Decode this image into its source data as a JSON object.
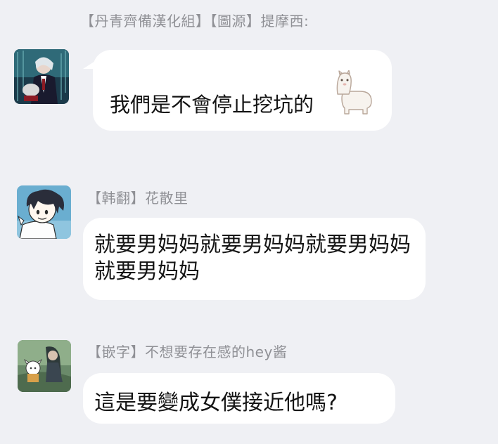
{
  "messages": [
    {
      "sender": "【丹青齊備漢化組】【圖源】提摩西:",
      "text": "我們是不會停止挖坑的",
      "sticker_icon": "alpaca-icon"
    },
    {
      "sender": "【韩翻】花散里",
      "text": "就要男妈妈就要男妈妈就要男妈妈就要男妈妈"
    },
    {
      "sender": "【嵌字】不想要存在感的hey酱",
      "text": "這是要變成女僕接近他嗎?"
    }
  ],
  "colors": {
    "background": "#eff0f4",
    "bubble": "#ffffff",
    "sender_text": "#8f9095",
    "message_text": "#141414"
  }
}
